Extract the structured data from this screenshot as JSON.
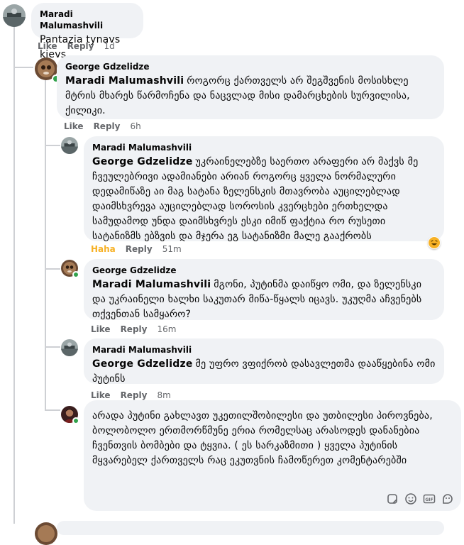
{
  "comment1": {
    "author": "Maradi Malumashvili",
    "text": "Pantazia tynavs kievs",
    "like": "Like",
    "reply": "Reply",
    "time": "1d"
  },
  "reply1": {
    "author": "George Gdzelidze",
    "mention": "Maradi Malumashvili",
    "text": "როგორც ქართველს არ შეგშვენის მოსისხლე მტრის მხარეს წარმოჩენა და ნაცვლად მისი დამარცხების სურვილისა, ქილიკი.",
    "like": "Like",
    "reply": "Reply",
    "time": "6h"
  },
  "reply2": {
    "author": "Maradi Malumashvili",
    "mention": "George Gdzelidze",
    "text": "უკრაინელებზე საერთო არაფერი არ მაქვს მე ჩვეულებრივი ადამიანები არიან როგორც ყველა ნორმალური დედამიწაზე აი მაგ სატანა ზელენსკის მთავრობა აუცილებლად დაიმსხვრევა აუცილებლად სოროსის კვერცხები ერთხელდა სამუდამოდ უნდა დაიმსხვრეს ესკი იმიწ ფაქტია რო რუსეთი სატანიზმს ებზვის და მჯერა ეგ სატანიზმი მალე გააქრობს",
    "haha": "Haha",
    "reply": "Reply",
    "time": "51m"
  },
  "reply3": {
    "author": "George Gdzelidze",
    "mention": "Maradi Malumashvili",
    "text": "მგონი, პუტინმა დაიწყო ომი, და ზელენსკი და უკრაინელი ხალხი საკუთარ მიწა-წყალს იცავს. უკუღმა აჩვენებს თქვენთან სამყარო?",
    "like": "Like",
    "reply": "Reply",
    "time": "16m"
  },
  "reply4": {
    "author": "Maradi Malumashvili",
    "mention": "George Gdzelidze",
    "text": "მე უფრო ვფიქრობ დასავლეთმა დააწყებინა ომი პუტინს",
    "like": "Like",
    "reply": "Reply",
    "time": "8m"
  },
  "composer": {
    "text": "არადა პუტინი გახლავთ უკეთილშობილესი და უთბილესი პიროვნება, ბოლობოლო ერთმორწმუნე ერია რომელსაც არასოდეს დანანებია ჩვენთვის ბომბები და ტყვია. ( ეს სარკაზმითი ) ყველა პუტინის მყვარებელ ქართველს რაც ეკუთვნის ჩამოწერეთ კომენტარებში",
    "tools": [
      "sticker-icon",
      "emoji-icon",
      "gif-icon",
      "sticker-face-icon"
    ],
    "gif_label": "GIF"
  },
  "colors": {
    "bubble": "#f0f2f5",
    "meta": "#65676b",
    "haha": "#f7b125",
    "online": "#31a24c"
  }
}
